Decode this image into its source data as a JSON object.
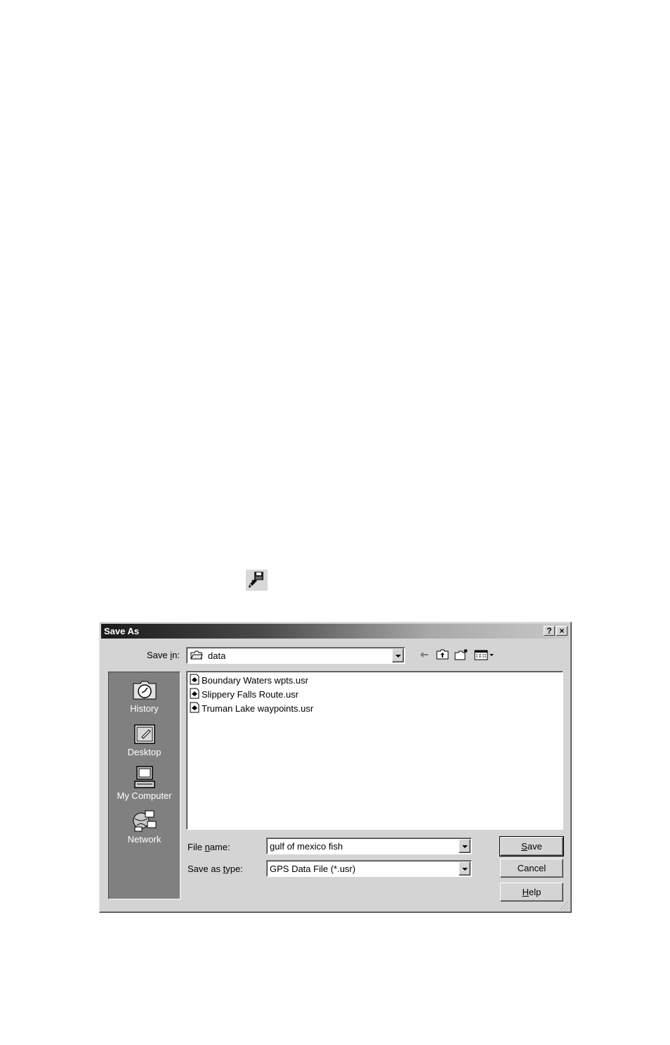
{
  "dialog": {
    "title": "Save As",
    "help_btn": "?",
    "close_btn": "×"
  },
  "save_in": {
    "label_pre": "Save ",
    "label_ul": "i",
    "label_post": "n:",
    "value": "data"
  },
  "places": [
    {
      "label": "History"
    },
    {
      "label": "Desktop"
    },
    {
      "label": "My Computer"
    },
    {
      "label": "Network"
    }
  ],
  "files": [
    {
      "name": "Boundary Waters wpts.usr"
    },
    {
      "name": "Slippery Falls Route.usr"
    },
    {
      "name": "Truman Lake waypoints.usr"
    }
  ],
  "file_name": {
    "label_pre": "File ",
    "label_ul": "n",
    "label_post": "ame:",
    "value": "gulf of mexico fish"
  },
  "save_type": {
    "label_pre": "Save as ",
    "label_ul": "t",
    "label_post": "ype:",
    "value": "GPS Data File (*.usr)"
  },
  "buttons": {
    "save_ul": "S",
    "save_rest": "ave",
    "cancel": "Cancel",
    "help_ul": "H",
    "help_rest": "elp"
  },
  "icons": {
    "toolbar_icon": "save-to-gps-icon",
    "back": "back-arrow-icon",
    "up": "up-folder-icon",
    "new_folder": "new-folder-icon",
    "views": "views-menu-icon"
  }
}
